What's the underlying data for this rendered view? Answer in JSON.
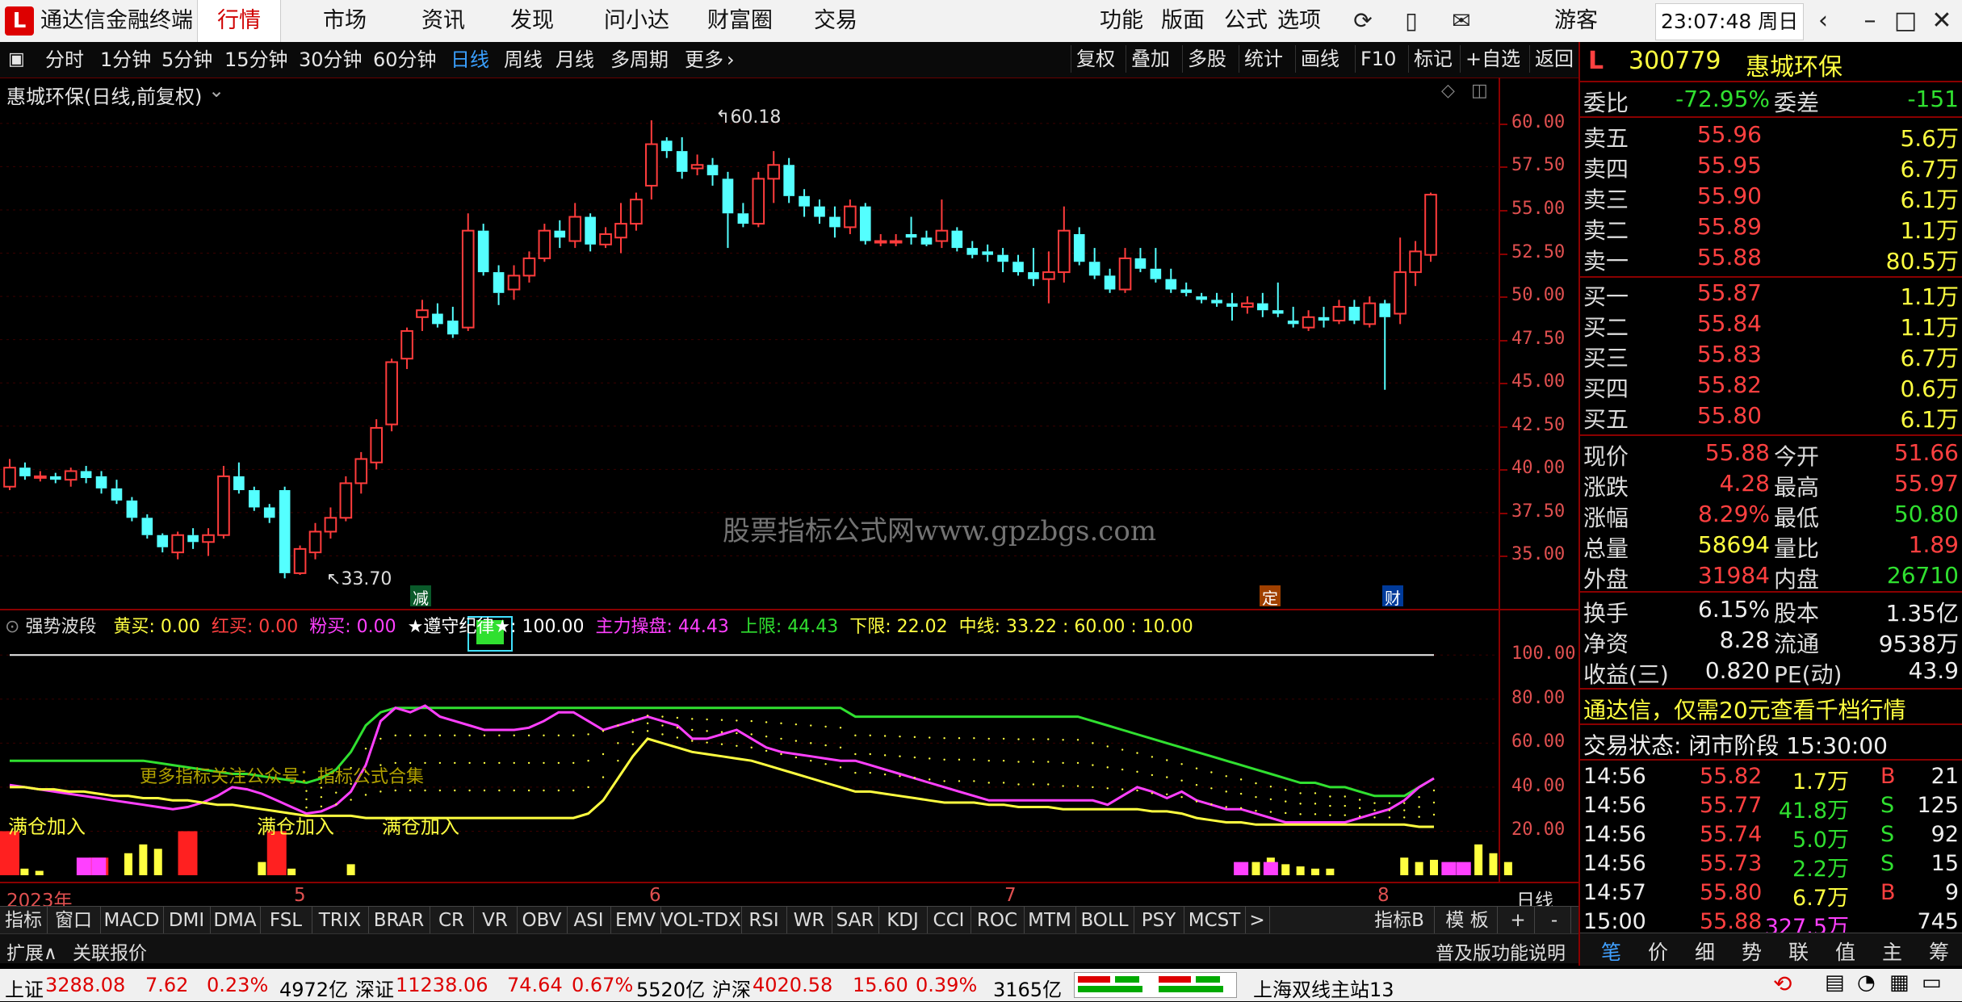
{
  "app": {
    "title": "通达信金融终端"
  },
  "menu": [
    "行情",
    "市场",
    "资讯",
    "发现",
    "问小达",
    "财富圈",
    "交易"
  ],
  "menu_active": 0,
  "menu_right": [
    "功能",
    "版面",
    "公式",
    "选项"
  ],
  "user": "游客",
  "clock": "23:07:48 周日",
  "periods": [
    "分时",
    "1分钟",
    "5分钟",
    "15分钟",
    "30分钟",
    "60分钟",
    "日线",
    "周线",
    "月线",
    "多周期",
    "更多"
  ],
  "period_active": 6,
  "toolbar_right": [
    "复权",
    "叠加",
    "多股",
    "统计",
    "画线",
    "F10",
    "标记",
    "+自选",
    "返回"
  ],
  "chart_title": "惠城环保(日线,前复权)",
  "watermark": "股票指标公式网www.gpzbgs.com",
  "main_chart": {
    "y_ticks": [
      "60.00",
      "57.50",
      "55.00",
      "52.50",
      "50.00",
      "47.50",
      "45.00",
      "42.50",
      "40.00",
      "37.50",
      "35.00"
    ],
    "high_label": "60.18",
    "low_label": "33.70",
    "markers": [
      "减",
      "定",
      "财"
    ]
  },
  "chart_data": {
    "type": "candlestick",
    "ylim": [
      32.5,
      62.0
    ],
    "y_ticks": [
      35.0,
      37.5,
      40.0,
      42.5,
      45.0,
      47.5,
      50.0,
      52.5,
      55.0,
      57.5,
      60.0
    ],
    "x_labels": [
      "2023年",
      "5",
      "6",
      "7",
      "8",
      "日线"
    ],
    "candles": [
      [
        39.0,
        40.6,
        38.8,
        40.1
      ],
      [
        40.1,
        40.4,
        39.4,
        39.6
      ],
      [
        39.6,
        39.9,
        39.3,
        39.6
      ],
      [
        39.6,
        39.8,
        39.2,
        39.4
      ],
      [
        39.4,
        40.1,
        39.0,
        39.9
      ],
      [
        39.9,
        40.2,
        39.2,
        39.5
      ],
      [
        39.6,
        39.9,
        38.6,
        38.9
      ],
      [
        38.9,
        39.4,
        38.0,
        38.2
      ],
      [
        38.2,
        38.4,
        37.0,
        37.2
      ],
      [
        37.2,
        37.4,
        36.0,
        36.2
      ],
      [
        36.2,
        36.3,
        35.2,
        35.5
      ],
      [
        35.2,
        36.4,
        34.8,
        36.2
      ],
      [
        36.2,
        36.6,
        35.4,
        35.8
      ],
      [
        35.8,
        36.6,
        35.0,
        36.2
      ],
      [
        36.2,
        40.2,
        36.0,
        39.6
      ],
      [
        39.6,
        40.4,
        38.6,
        38.8
      ],
      [
        38.8,
        39.0,
        37.6,
        37.8
      ],
      [
        37.8,
        38.0,
        36.9,
        37.2
      ],
      [
        38.8,
        39.0,
        33.7,
        34.0
      ],
      [
        34.0,
        35.6,
        33.9,
        35.4
      ],
      [
        35.2,
        36.9,
        34.8,
        36.4
      ],
      [
        36.4,
        37.8,
        36.0,
        37.2
      ],
      [
        37.2,
        39.6,
        37.0,
        39.2
      ],
      [
        39.2,
        41.0,
        38.6,
        40.6
      ],
      [
        40.4,
        42.9,
        40.0,
        42.4
      ],
      [
        42.6,
        46.4,
        42.2,
        46.2
      ],
      [
        46.4,
        48.2,
        45.8,
        48.0
      ],
      [
        48.8,
        49.8,
        48.0,
        49.2
      ],
      [
        49.0,
        49.6,
        48.2,
        48.4
      ],
      [
        48.6,
        49.4,
        47.6,
        47.8
      ],
      [
        48.2,
        54.8,
        48.0,
        53.8
      ],
      [
        53.8,
        54.2,
        51.2,
        51.4
      ],
      [
        51.4,
        51.8,
        49.5,
        50.2
      ],
      [
        50.4,
        51.8,
        49.8,
        51.2
      ],
      [
        51.2,
        52.6,
        50.8,
        52.2
      ],
      [
        52.2,
        54.2,
        52.0,
        53.8
      ],
      [
        53.8,
        54.4,
        52.8,
        53.4
      ],
      [
        53.2,
        55.4,
        52.8,
        54.6
      ],
      [
        54.6,
        54.8,
        52.6,
        53.0
      ],
      [
        53.0,
        54.0,
        52.8,
        53.6
      ],
      [
        53.4,
        55.4,
        52.5,
        54.2
      ],
      [
        54.2,
        56.0,
        53.8,
        55.6
      ],
      [
        56.4,
        60.18,
        55.6,
        58.8
      ],
      [
        59.0,
        59.2,
        58.0,
        58.4
      ],
      [
        58.4,
        59.2,
        56.8,
        57.2
      ],
      [
        57.4,
        58.2,
        57.0,
        57.6
      ],
      [
        57.6,
        58.0,
        56.4,
        57.0
      ],
      [
        56.8,
        57.2,
        52.8,
        54.8
      ],
      [
        54.8,
        55.4,
        54.0,
        54.2
      ],
      [
        54.2,
        57.2,
        54.0,
        56.8
      ],
      [
        56.8,
        58.4,
        55.4,
        57.6
      ],
      [
        57.6,
        58.0,
        55.4,
        55.8
      ],
      [
        55.8,
        56.2,
        54.6,
        55.2
      ],
      [
        55.2,
        55.6,
        54.2,
        54.6
      ],
      [
        54.6,
        55.2,
        53.4,
        54.0
      ],
      [
        54.0,
        55.6,
        53.6,
        55.2
      ],
      [
        55.2,
        55.4,
        53.0,
        53.2
      ],
      [
        53.2,
        53.6,
        52.9,
        53.2
      ],
      [
        53.2,
        53.6,
        52.9,
        53.2
      ],
      [
        53.6,
        54.6,
        53.0,
        53.4
      ],
      [
        53.4,
        53.8,
        52.9,
        53.0
      ],
      [
        53.2,
        55.6,
        52.8,
        53.8
      ],
      [
        53.8,
        54.0,
        52.6,
        52.8
      ],
      [
        52.8,
        53.2,
        52.2,
        52.4
      ],
      [
        52.6,
        53.0,
        52.0,
        52.4
      ],
      [
        52.4,
        52.8,
        51.4,
        52.0
      ],
      [
        52.0,
        52.4,
        51.2,
        51.4
      ],
      [
        51.4,
        52.8,
        50.6,
        51.0
      ],
      [
        51.0,
        52.6,
        49.6,
        51.4
      ],
      [
        51.4,
        55.2,
        50.8,
        53.8
      ],
      [
        53.6,
        54.0,
        51.8,
        52.0
      ],
      [
        52.0,
        52.8,
        51.0,
        51.2
      ],
      [
        51.2,
        51.6,
        50.2,
        50.4
      ],
      [
        50.4,
        52.8,
        50.2,
        52.2
      ],
      [
        52.2,
        52.8,
        51.4,
        51.6
      ],
      [
        51.6,
        52.8,
        50.8,
        51.0
      ],
      [
        51.0,
        51.6,
        50.2,
        50.4
      ],
      [
        50.4,
        50.8,
        50.0,
        50.2
      ],
      [
        50.0,
        50.2,
        49.6,
        49.8
      ],
      [
        49.8,
        50.2,
        49.4,
        49.6
      ],
      [
        49.6,
        50.2,
        48.6,
        49.4
      ],
      [
        49.4,
        50.0,
        49.0,
        49.6
      ],
      [
        49.6,
        50.2,
        48.8,
        49.2
      ],
      [
        49.2,
        50.8,
        48.8,
        49.0
      ],
      [
        48.6,
        49.4,
        48.2,
        48.4
      ],
      [
        48.2,
        49.2,
        48.0,
        48.8
      ],
      [
        48.8,
        49.4,
        48.2,
        48.6
      ],
      [
        48.6,
        49.8,
        48.4,
        49.4
      ],
      [
        49.4,
        49.8,
        48.4,
        48.6
      ],
      [
        48.4,
        50.0,
        48.2,
        49.6
      ],
      [
        49.6,
        49.8,
        44.6,
        48.8
      ],
      [
        49.0,
        53.4,
        48.4,
        51.4
      ],
      [
        51.4,
        53.2,
        50.6,
        52.6
      ],
      [
        52.4,
        56.0,
        52.0,
        55.88
      ]
    ]
  },
  "indicator": {
    "name": "强势波段",
    "values": [
      {
        "label": "黄买: ",
        "value": "0.00",
        "color": "#ffff40"
      },
      {
        "label": "红买: ",
        "value": "0.00",
        "color": "#ff4040"
      },
      {
        "label": "粉买: ",
        "value": "0.00",
        "color": "#ff40ff"
      },
      {
        "label": "★遵守纪律★: ",
        "value": "100.00",
        "color": "#ffffff"
      },
      {
        "label": "主力操盘: ",
        "value": "44.43",
        "color": "#ff40ff"
      },
      {
        "label": "上限: ",
        "value": "44.43",
        "color": "#30e030"
      },
      {
        "label": "下限: ",
        "value": "22.02",
        "color": "#ffff40"
      },
      {
        "label": "中线: ",
        "value": "33.22 : 60.00 : 10.00",
        "color": "#ffff40"
      }
    ],
    "y_ticks": [
      "100.00",
      "80.00",
      "60.00",
      "40.00",
      "20.00"
    ],
    "annotations": [
      "满仓加入",
      "满仓加入",
      "满仓加入"
    ],
    "note": "更多指标关注公众号：指标公式合集"
  },
  "indicator_chart": {
    "ylim": [
      0,
      110
    ],
    "green": [
      52,
      52,
      52,
      52,
      52,
      52,
      52,
      52,
      52,
      52,
      51,
      50,
      49,
      48,
      47,
      46,
      46,
      45,
      44,
      43,
      42,
      44,
      48,
      56,
      68,
      74,
      76,
      76,
      76,
      76,
      76,
      76,
      76,
      76,
      76,
      76,
      76,
      76,
      76,
      76,
      76,
      76,
      76,
      76,
      76,
      76,
      76,
      76,
      76,
      76,
      76,
      76,
      76,
      76,
      76,
      76,
      76,
      72,
      72,
      72,
      72,
      72,
      72,
      72,
      72,
      72,
      72,
      72,
      72,
      72,
      72,
      72,
      72,
      70,
      68,
      66,
      64,
      62,
      60,
      58,
      56,
      54,
      52,
      50,
      48,
      46,
      44,
      42,
      42,
      40,
      40,
      38,
      36,
      36,
      36,
      40,
      44
    ],
    "magenta": [
      41,
      40,
      39,
      38,
      37,
      36,
      35,
      34,
      33,
      32,
      31,
      30,
      31,
      33,
      36,
      40,
      39,
      37,
      34,
      31,
      28,
      29,
      32,
      38,
      50,
      70,
      76,
      74,
      77,
      72,
      70,
      68,
      66,
      66,
      66,
      67,
      70,
      74,
      74,
      70,
      66,
      68,
      70,
      72,
      70,
      68,
      62,
      62,
      64,
      66,
      62,
      58,
      56,
      55,
      54,
      53,
      52,
      52,
      50,
      48,
      46,
      44,
      42,
      40,
      38,
      36,
      34,
      34,
      34,
      34,
      34,
      34,
      34,
      34,
      32,
      36,
      40,
      38,
      35,
      38,
      34,
      32,
      30,
      30,
      28,
      26,
      24,
      24,
      24,
      24,
      24,
      26,
      28,
      30,
      34,
      40,
      44
    ],
    "yellow": [
      40,
      40,
      39,
      39,
      38,
      38,
      37,
      36,
      36,
      35,
      35,
      34,
      34,
      33,
      32,
      32,
      31,
      30,
      29,
      28,
      27,
      27,
      27,
      27,
      26,
      26,
      26,
      26,
      26,
      26,
      26,
      26,
      26,
      26,
      26,
      26,
      26,
      26,
      26,
      28,
      34,
      44,
      54,
      62,
      60,
      58,
      56,
      55,
      54,
      53,
      52,
      50,
      48,
      46,
      44,
      42,
      40,
      38,
      38,
      37,
      36,
      35,
      34,
      33,
      33,
      33,
      32,
      32,
      31,
      31,
      31,
      30,
      30,
      30,
      30,
      30,
      30,
      29,
      29,
      28,
      26,
      25,
      24,
      24,
      23,
      23,
      23,
      23,
      23,
      23,
      23,
      23,
      23,
      23,
      23,
      22,
      22
    ],
    "yellow_bars": [
      [
        0,
        8
      ],
      [
        1,
        3
      ],
      [
        2,
        2
      ],
      [
        8,
        10
      ],
      [
        9,
        14
      ],
      [
        10,
        12
      ],
      [
        17,
        6
      ],
      [
        18,
        4
      ],
      [
        19,
        3
      ],
      [
        23,
        5
      ],
      [
        84,
        6
      ],
      [
        85,
        8
      ],
      [
        86,
        5
      ],
      [
        87,
        4
      ],
      [
        88,
        3
      ],
      [
        89,
        3
      ],
      [
        94,
        8
      ],
      [
        95,
        6
      ],
      [
        96,
        7
      ],
      [
        97,
        5
      ],
      [
        98,
        4
      ],
      [
        99,
        14
      ],
      [
        100,
        10
      ],
      [
        101,
        6
      ]
    ],
    "red_bars": [
      [
        0,
        20
      ],
      [
        6,
        8
      ],
      [
        12,
        20
      ],
      [
        18,
        20
      ]
    ],
    "magenta_bars": [
      [
        5,
        8
      ],
      [
        6,
        8
      ],
      [
        83,
        6
      ],
      [
        85,
        6
      ],
      [
        97,
        6
      ],
      [
        98,
        6
      ]
    ]
  },
  "x_axis": {
    "labels": [
      "2023年",
      "5",
      "6",
      "7",
      "8"
    ],
    "period": "日线"
  },
  "indicator_tabs": [
    "指标A",
    "窗口",
    "MACD",
    "DMI",
    "DMA",
    "FSL",
    "TRIX",
    "BRAR",
    "CR",
    "VR",
    "OBV",
    "ASI",
    "EMV",
    "VOL-TDX",
    "RSI",
    "WR",
    "SAR",
    "KDJ",
    "CCI",
    "ROC",
    "MTM",
    "BOLL",
    "PSY",
    "MCST",
    ">"
  ],
  "indicator_tabs_right": [
    "指标B",
    "模 板",
    "+",
    "-"
  ],
  "bottom_left": [
    "扩展∧",
    "关联报价"
  ],
  "bottom_right": "普及版功能说明",
  "quote": {
    "code": "300779",
    "name": "惠城环保",
    "weibi_label": "委比",
    "weibi": "-72.95%",
    "weicha_label": "委差",
    "weicha": "-151",
    "sell": [
      {
        "label": "卖五",
        "price": "55.96",
        "vol": "5.6万"
      },
      {
        "label": "卖四",
        "price": "55.95",
        "vol": "6.7万"
      },
      {
        "label": "卖三",
        "price": "55.90",
        "vol": "6.1万"
      },
      {
        "label": "卖二",
        "price": "55.89",
        "vol": "1.1万"
      },
      {
        "label": "卖一",
        "price": "55.88",
        "vol": "80.5万"
      }
    ],
    "buy": [
      {
        "label": "买一",
        "price": "55.87",
        "vol": "1.1万"
      },
      {
        "label": "买二",
        "price": "55.84",
        "vol": "1.1万"
      },
      {
        "label": "买三",
        "price": "55.83",
        "vol": "6.7万"
      },
      {
        "label": "买四",
        "price": "55.82",
        "vol": "0.6万"
      },
      {
        "label": "买五",
        "price": "55.80",
        "vol": "6.1万"
      }
    ],
    "stats": [
      {
        "l1": "现价",
        "v1": "55.88",
        "c1": "red",
        "l2": "今开",
        "v2": "51.66",
        "c2": "red"
      },
      {
        "l1": "涨跌",
        "v1": "4.28",
        "c1": "red",
        "l2": "最高",
        "v2": "55.97",
        "c2": "red"
      },
      {
        "l1": "涨幅",
        "v1": "8.29%",
        "c1": "red",
        "l2": "最低",
        "v2": "50.80",
        "c2": "green"
      },
      {
        "l1": "总量",
        "v1": "58694",
        "c1": "yellow",
        "l2": "量比",
        "v2": "1.89",
        "c2": "red"
      },
      {
        "l1": "外盘",
        "v1": "31984",
        "c1": "red",
        "l2": "内盘",
        "v2": "26710",
        "c2": "green"
      }
    ],
    "stats2": [
      {
        "l1": "换手",
        "v1": "6.15%",
        "l2": "股本",
        "v2": "1.35亿"
      },
      {
        "l1": "净资",
        "v1": "8.28",
        "l2": "流通",
        "v2": "9538万"
      },
      {
        "l1": "收益(三)",
        "v1": "0.820",
        "l2": "PE(动)",
        "v2": "43.9"
      }
    ],
    "promo": "通达信，仅需20元查看千档行情",
    "trade_status": "交易状态: 闭市阶段 15:30:00",
    "ticks": [
      {
        "t": "14:56",
        "p": "55.82",
        "v": "1.7万",
        "s": "B",
        "n": "21"
      },
      {
        "t": "14:56",
        "p": "55.77",
        "v": "41.8万",
        "s": "S",
        "n": "125"
      },
      {
        "t": "14:56",
        "p": "55.74",
        "v": "5.0万",
        "s": "S",
        "n": "92"
      },
      {
        "t": "14:56",
        "p": "55.73",
        "v": "2.2万",
        "s": "S",
        "n": "15"
      },
      {
        "t": "14:57",
        "p": "55.80",
        "v": "6.7万",
        "s": "B",
        "n": "9"
      },
      {
        "t": "15:00",
        "p": "55.88",
        "v": "327.5万",
        "s": "",
        "n": "745"
      }
    ],
    "tabs": [
      "笔",
      "价",
      "细",
      "势",
      "联",
      "值",
      "主",
      "筹"
    ]
  },
  "status": {
    "sh_label": "上证",
    "sh": "3288.08",
    "sh_chg": "7.62",
    "sh_pct": "0.23%",
    "sh_amt": "4972亿",
    "sz_label": "深证",
    "sz": "11238.06",
    "sz_chg": "74.64",
    "sz_pct": "0.67%",
    "sz_amt": "5520亿",
    "hs_label": "沪深",
    "hs": "4020.58",
    "hs_chg": "15.60",
    "hs_pct": "0.39%",
    "hs_amt": "3165亿",
    "server": "上海双线主站13"
  }
}
